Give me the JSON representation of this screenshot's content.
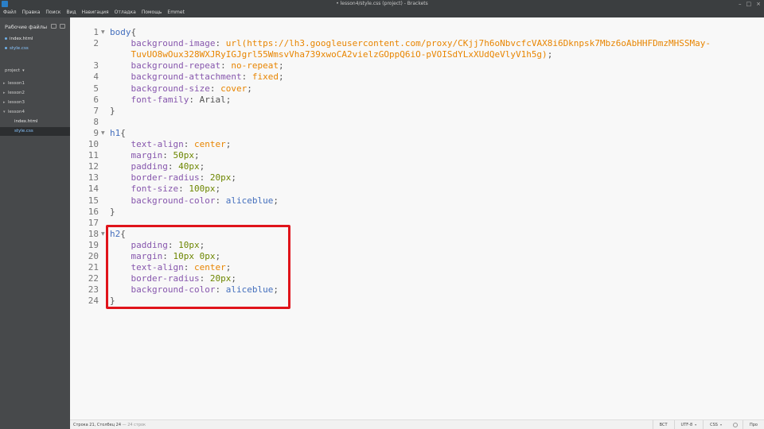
{
  "window": {
    "title": "• lesson4/style.css (project) - Brackets"
  },
  "menu": [
    "Файл",
    "Правка",
    "Поиск",
    "Вид",
    "Навигация",
    "Отладка",
    "Помощь",
    "Emmet"
  ],
  "sidebar": {
    "working_files_header": "Рабочие файлы",
    "working_files": [
      {
        "name": "index.html",
        "selected": false
      },
      {
        "name": "style.css",
        "selected": true
      }
    ],
    "project_label": "project",
    "tree": [
      "lesson1",
      "lesson2",
      "lesson3",
      "lesson4"
    ],
    "lesson4_files": [
      {
        "name": "index.html",
        "selected": false
      },
      {
        "name": "style.css",
        "selected": true
      }
    ]
  },
  "editor": {
    "line_numbers": [
      "1",
      "2",
      "",
      "3",
      "4",
      "5",
      "6",
      "7",
      "8",
      "9",
      "10",
      "11",
      "12",
      "13",
      "14",
      "15",
      "16",
      "17",
      "18",
      "19",
      "20",
      "21",
      "22",
      "23",
      "24"
    ],
    "fold_markers": [
      "1",
      "9",
      "18"
    ],
    "lines": [
      {
        "parts": [
          [
            "sel",
            "body"
          ],
          [
            "punc",
            "{"
          ]
        ]
      },
      {
        "parts": [
          [
            "ind",
            "    "
          ],
          [
            "prop",
            "background-image"
          ],
          [
            "punc",
            ": "
          ],
          [
            "val",
            "url(https://lh3.googleusercontent.com/proxy/CKjj7h6oNbvcfcVAX8i6Dknpsk7Mbz6oAbHHFDmzMHSSMay-"
          ]
        ]
      },
      {
        "parts": [
          [
            "ind",
            "    "
          ],
          [
            "val",
            "TuvUO8wOux328WXJRyIGJgrl55WmsvVha739xwoCA2vielzGOppQ6iO-pVOISdYLxXUdQeVlyV1h5g)"
          ],
          [
            "punc",
            ";"
          ]
        ]
      },
      {
        "parts": [
          [
            "ind",
            "    "
          ],
          [
            "prop",
            "background-repeat"
          ],
          [
            "punc",
            ": "
          ],
          [
            "val",
            "no-repeat"
          ],
          [
            "punc",
            ";"
          ]
        ]
      },
      {
        "parts": [
          [
            "ind",
            "    "
          ],
          [
            "prop",
            "background-attachment"
          ],
          [
            "punc",
            ": "
          ],
          [
            "val",
            "fixed"
          ],
          [
            "punc",
            ";"
          ]
        ]
      },
      {
        "parts": [
          [
            "ind",
            "    "
          ],
          [
            "prop",
            "background-size"
          ],
          [
            "punc",
            ": "
          ],
          [
            "val",
            "cover"
          ],
          [
            "punc",
            ";"
          ]
        ]
      },
      {
        "parts": [
          [
            "ind",
            "    "
          ],
          [
            "prop",
            "font-family"
          ],
          [
            "punc",
            ": Arial;"
          ]
        ]
      },
      {
        "parts": [
          [
            "punc",
            "}"
          ]
        ]
      },
      {
        "parts": []
      },
      {
        "parts": [
          [
            "sel",
            "h1"
          ],
          [
            "punc",
            "{"
          ]
        ]
      },
      {
        "parts": [
          [
            "ind",
            "    "
          ],
          [
            "prop",
            "text-align"
          ],
          [
            "punc",
            ": "
          ],
          [
            "val",
            "center"
          ],
          [
            "punc",
            ";"
          ]
        ]
      },
      {
        "parts": [
          [
            "ind",
            "    "
          ],
          [
            "prop",
            "margin"
          ],
          [
            "punc",
            ": "
          ],
          [
            "num",
            "50px"
          ],
          [
            "punc",
            ";"
          ]
        ]
      },
      {
        "parts": [
          [
            "ind",
            "    "
          ],
          [
            "prop",
            "padding"
          ],
          [
            "punc",
            ": "
          ],
          [
            "num",
            "40px"
          ],
          [
            "punc",
            ";"
          ]
        ]
      },
      {
        "parts": [
          [
            "ind",
            "    "
          ],
          [
            "prop",
            "border-radius"
          ],
          [
            "punc",
            ": "
          ],
          [
            "num",
            "20px"
          ],
          [
            "punc",
            ";"
          ]
        ]
      },
      {
        "parts": [
          [
            "ind",
            "    "
          ],
          [
            "prop",
            "font-size"
          ],
          [
            "punc",
            ": "
          ],
          [
            "num",
            "100px"
          ],
          [
            "punc",
            ";"
          ]
        ]
      },
      {
        "parts": [
          [
            "ind",
            "    "
          ],
          [
            "prop",
            "background-color"
          ],
          [
            "punc",
            ": "
          ],
          [
            "sel",
            "aliceblue"
          ],
          [
            "punc",
            ";"
          ]
        ]
      },
      {
        "parts": [
          [
            "punc",
            "}"
          ]
        ]
      },
      {
        "parts": []
      },
      {
        "parts": [
          [
            "sel",
            "h2"
          ],
          [
            "punc",
            "{"
          ]
        ]
      },
      {
        "parts": [
          [
            "ind",
            "    "
          ],
          [
            "prop",
            "padding"
          ],
          [
            "punc",
            ": "
          ],
          [
            "num",
            "10px"
          ],
          [
            "punc",
            ";"
          ]
        ]
      },
      {
        "parts": [
          [
            "ind",
            "    "
          ],
          [
            "prop",
            "margin"
          ],
          [
            "punc",
            ": "
          ],
          [
            "num",
            "10px 0px"
          ],
          [
            "punc",
            ";"
          ]
        ]
      },
      {
        "parts": [
          [
            "ind",
            "    "
          ],
          [
            "prop",
            "text-align"
          ],
          [
            "punc",
            ": "
          ],
          [
            "val",
            "center"
          ],
          [
            "punc",
            ";"
          ]
        ]
      },
      {
        "parts": [
          [
            "ind",
            "    "
          ],
          [
            "prop",
            "border-radius"
          ],
          [
            "punc",
            ": "
          ],
          [
            "num",
            "20px"
          ],
          [
            "punc",
            ";"
          ]
        ]
      },
      {
        "parts": [
          [
            "ind",
            "    "
          ],
          [
            "prop",
            "background-color"
          ],
          [
            "punc",
            ": "
          ],
          [
            "sel",
            "aliceblue"
          ],
          [
            "punc",
            ";"
          ]
        ]
      },
      {
        "parts": [
          [
            "punc",
            "}"
          ]
        ]
      }
    ]
  },
  "statusbar": {
    "position": "Строка 21, Столбец 24",
    "lines_count": "— 24 строк",
    "insert_mode": "ВСТ",
    "encoding": "UTF-8",
    "language": "CSS",
    "extra": "Про"
  },
  "colors": {
    "highlight_border": "#e0141b",
    "selector": "#446fbd",
    "property": "#8757ad",
    "value": "#e88501",
    "number": "#6d8600"
  }
}
